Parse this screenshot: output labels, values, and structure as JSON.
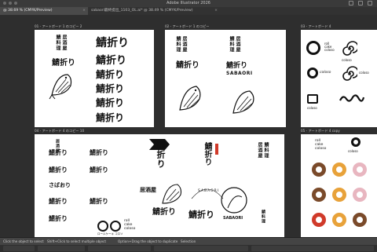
{
  "window": {
    "title": "Adobe Illustrator 2026"
  },
  "tabs": [
    {
      "label": "@ 38.69 % (CMYK/Preview)",
      "active": true
    },
    {
      "label": "sabaori最終提出_1103_OL.ai* @ 38.49 % (CMYK/Preview)",
      "active": false
    }
  ],
  "artboards": {
    "a1": {
      "label": "01 - アートボード 1 のコピー 2"
    },
    "a2": {
      "label": "02 - アートボード 1 のコピー"
    },
    "a3": {
      "label": "03 - アートボード 4"
    },
    "a4": {
      "label": "04 - アートボード 4 のコピー 10"
    },
    "a5": {
      "label": "05 - アートボード 4 copy"
    }
  },
  "logo": {
    "name_jp": "鯖折り",
    "brand_jp_vertical": "居酒屋",
    "sub_jp_vertical": "鯖料理",
    "romaji": "SABAORI",
    "hiragana": "さばおり",
    "cake_lines": [
      "roll",
      "cake",
      "coloso"
    ],
    "cake_caption": "ロールケーキ コロソ",
    "coloso": "coloso"
  },
  "status": {
    "hint1": "Click the object to select",
    "hint2": "Shift+Click to select multiple object",
    "hint3": "Option+Drag the object to duplicate",
    "zoom": "Selection"
  },
  "colors": {
    "chrome": "#3a3a3a",
    "canvas": "#2e2e2e",
    "swatch_brown": "#7a4a2a",
    "swatch_orange": "#e8a23a",
    "swatch_pink": "#e8b6c0",
    "swatch_red": "#d03a2a"
  }
}
